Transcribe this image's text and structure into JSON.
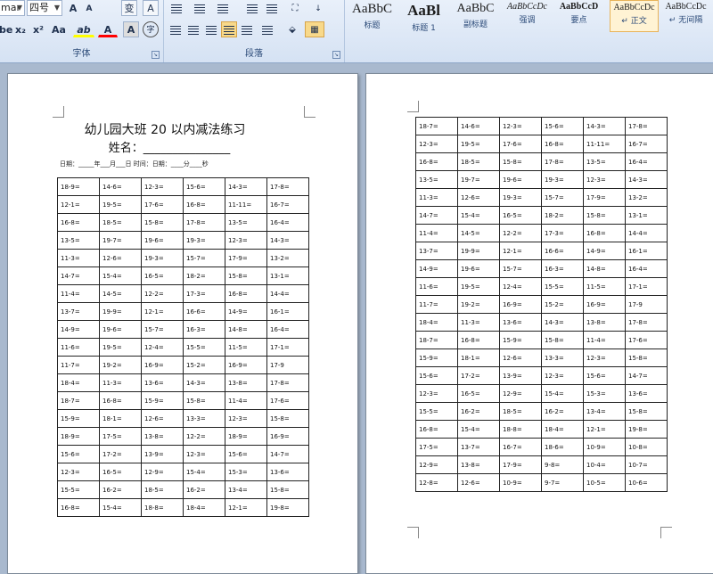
{
  "ribbon": {
    "font_group": {
      "label": "字体",
      "font_name": "mar",
      "font_size": "四号",
      "grow": "A",
      "shrink": "A",
      "pinyin": "变",
      "clear_format": "A",
      "bold": "be",
      "subscript": "x₂",
      "superscript": "x²",
      "change_case": "Aa",
      "highlight": "ab",
      "font_color": "A",
      "char_shading": "A",
      "enclose": "字"
    },
    "paragraph_group": {
      "label": "段落"
    },
    "styles": [
      {
        "sample": "AaBbC",
        "name": "标题"
      },
      {
        "sample": "AaBl",
        "name": "标题 1"
      },
      {
        "sample": "AaBbC",
        "name": "副标题"
      },
      {
        "sample": "AaBbCcDc",
        "name": "强调"
      },
      {
        "sample": "AaBbCcD",
        "name": "要点"
      },
      {
        "sample": "AaBbCcDc",
        "name": "↵ 正文"
      },
      {
        "sample": "AaBbCcDc",
        "name": "↵ 无间隔"
      }
    ],
    "colors": {
      "highlight": "#ffff00",
      "font_color": "#ff0000",
      "shading": "#f5d488"
    }
  },
  "page1": {
    "title": "幼儿园大班 20 以内减法练习",
    "name_line": "姓名：_______________",
    "date_line": "日期：_____年___月___日      时间：日期：____分____秒",
    "rows": [
      [
        "18-9=",
        "14-6=",
        "12-3=",
        "15-6=",
        "14-3=",
        "17-8="
      ],
      [
        "12-1=",
        "19-5=",
        "17-6=",
        "16-8=",
        "11-11=",
        "16-7="
      ],
      [
        "16-8=",
        "18-5=",
        "15-8=",
        "17-8=",
        "13-5=",
        "16-4="
      ],
      [
        "13-5=",
        "19-7=",
        "19-6=",
        "19-3=",
        "12-3=",
        "14-3="
      ],
      [
        "11-3=",
        "12-6=",
        "19-3=",
        "15-7=",
        "17-9=",
        "13-2="
      ],
      [
        "14-7=",
        "15-4=",
        "16-5=",
        "18-2=",
        "15-8=",
        "13-1="
      ],
      [
        "11-4=",
        "14-5=",
        "12-2=",
        "17-3=",
        "16-8=",
        "14-4="
      ],
      [
        "13-7=",
        "19-9=",
        "12-1=",
        "16-6=",
        "14-9=",
        "16-1="
      ],
      [
        "14-9=",
        "19-6=",
        "15-7=",
        "16-3=",
        "14-8=",
        "16-4="
      ],
      [
        "11-6=",
        "19-5=",
        "12-4=",
        "15-5=",
        "11-5=",
        "17-1="
      ],
      [
        "11-7=",
        "19-2=",
        "16-9=",
        "15-2=",
        "16-9=",
        "17-9"
      ],
      [
        "18-4=",
        "11-3=",
        "13-6=",
        "14-3=",
        "13-8=",
        "17-8="
      ],
      [
        "18-7=",
        "16-8=",
        "15-9=",
        "15-8=",
        "11-4=",
        "17-6="
      ],
      [
        "15-9=",
        "18-1=",
        "12-6=",
        "13-3=",
        "12-3=",
        "15-8="
      ],
      [
        "18-9=",
        "17-5=",
        "13-8=",
        "12-2=",
        "18-9=",
        "16-9="
      ],
      [
        "15-6=",
        "17-2=",
        "13-9=",
        "12-3=",
        "15-6=",
        "14-7="
      ],
      [
        "12-3=",
        "16-5=",
        "12-9=",
        "15-4=",
        "15-3=",
        "13-6="
      ],
      [
        "15-5=",
        "16-2=",
        "18-5=",
        "16-2=",
        "13-4=",
        "15-8="
      ],
      [
        "16-8=",
        "15-4=",
        "18-8=",
        "18-4=",
        "12-1=",
        "19-8="
      ]
    ]
  },
  "page2": {
    "rows": [
      [
        "18-7=",
        "14-6=",
        "12-3=",
        "15-6=",
        "14-3=",
        "17-8="
      ],
      [
        "12-3=",
        "19-5=",
        "17-6=",
        "16-8=",
        "11-11=",
        "16-7="
      ],
      [
        "16-8=",
        "18-5=",
        "15-8=",
        "17-8=",
        "13-5=",
        "16-4="
      ],
      [
        "13-5=",
        "19-7=",
        "19-6=",
        "19-3=",
        "12-3=",
        "14-3="
      ],
      [
        "11-3=",
        "12-6=",
        "19-3=",
        "15-7=",
        "17-9=",
        "13-2="
      ],
      [
        "14-7=",
        "15-4=",
        "16-5=",
        "18-2=",
        "15-8=",
        "13-1="
      ],
      [
        "11-4=",
        "14-5=",
        "12-2=",
        "17-3=",
        "16-8=",
        "14-4="
      ],
      [
        "13-7=",
        "19-9=",
        "12-1=",
        "16-6=",
        "14-9=",
        "16-1="
      ],
      [
        "14-9=",
        "19-6=",
        "15-7=",
        "16-3=",
        "14-8=",
        "16-4="
      ],
      [
        "11-6=",
        "19-5=",
        "12-4=",
        "15-5=",
        "11-5=",
        "17-1="
      ],
      [
        "11-7=",
        "19-2=",
        "16-9=",
        "15-2=",
        "16-9=",
        "17-9"
      ],
      [
        "18-4=",
        "11-3=",
        "13-6=",
        "14-3=",
        "13-8=",
        "17-8="
      ],
      [
        "18-7=",
        "16-8=",
        "15-9=",
        "15-8=",
        "11-4=",
        "17-6="
      ],
      [
        "15-9=",
        "18-1=",
        "12-6=",
        "13-3=",
        "12-3=",
        "15-8="
      ],
      [
        "15-6=",
        "17-2=",
        "13-9=",
        "12-3=",
        "15-6=",
        "14-7="
      ],
      [
        "12-3=",
        "16-5=",
        "12-9=",
        "15-4=",
        "15-3=",
        "13-6="
      ],
      [
        "15-5=",
        "16-2=",
        "18-5=",
        "16-2=",
        "13-4=",
        "15-8="
      ],
      [
        "16-8=",
        "15-4=",
        "18-8=",
        "18-4=",
        "12-1=",
        "19-8="
      ],
      [
        "17-5=",
        "13-7=",
        "16-7=",
        "18-6=",
        "10-9=",
        "10-8="
      ],
      [
        "12-9=",
        "13-8=",
        "17-9=",
        "9-8=",
        "10-4=",
        "10-7="
      ],
      [
        "12-8=",
        "12-6=",
        "10-9=",
        "9-7=",
        "10-5=",
        "10-6="
      ]
    ]
  }
}
